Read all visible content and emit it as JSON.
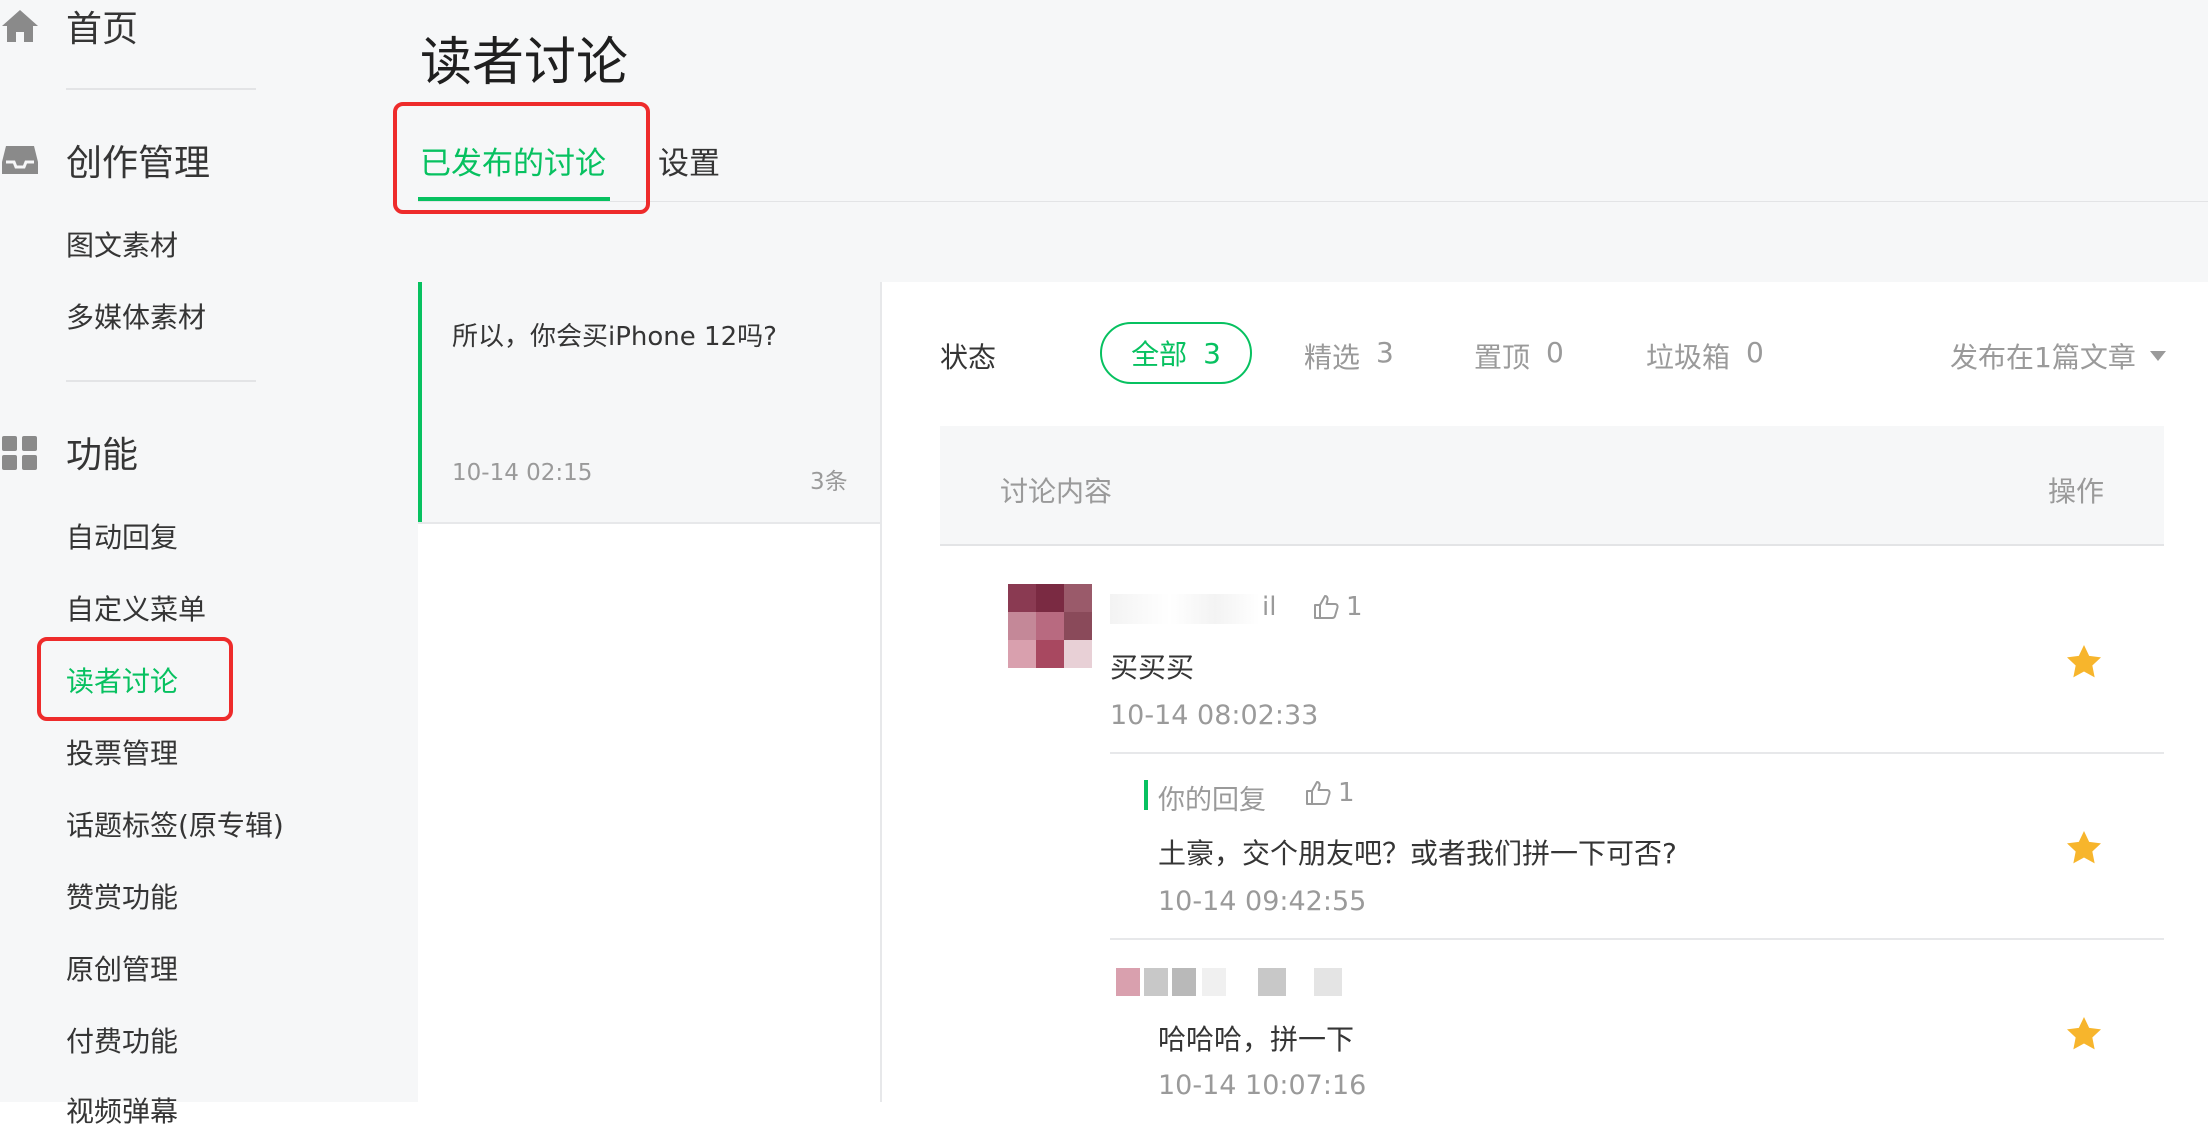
{
  "sidebar": {
    "sections": [
      {
        "label": "首页",
        "icon": "home-icon"
      },
      {
        "label": "创作管理",
        "icon": "inbox-icon"
      },
      {
        "label": "功能",
        "icon": "grid-icon"
      }
    ],
    "creation_items": [
      "图文素材",
      "多媒体素材"
    ],
    "function_items": [
      "自动回复",
      "自定义菜单",
      "读者讨论",
      "投票管理",
      "话题标签(原专辑)",
      "赞赏功能",
      "原创管理",
      "付费功能",
      "视频弹幕"
    ],
    "active_item": "读者讨论"
  },
  "header": {
    "title": "读者讨论",
    "tabs": [
      {
        "label": "已发布的讨论",
        "active": true
      },
      {
        "label": "设置",
        "active": false
      }
    ]
  },
  "articles": [
    {
      "title": "所以，你会买iPhone 12吗?",
      "time": "10-14 02:15",
      "count": "3条"
    }
  ],
  "filters": {
    "status_label": "状态",
    "items": [
      {
        "label": "全部",
        "count": "3",
        "active": true
      },
      {
        "label": "精选",
        "count": "3",
        "active": false
      },
      {
        "label": "置顶",
        "count": "0",
        "active": false
      },
      {
        "label": "垃圾箱",
        "count": "0",
        "active": false
      }
    ],
    "publish_dropdown": "发布在1篇文章"
  },
  "table": {
    "col_content": "讨论内容",
    "col_ops": "操作"
  },
  "comments": [
    {
      "name_visible": "il",
      "likes": "1",
      "text": "买买买",
      "time": "10-14 08:02:33",
      "starred": true
    },
    {
      "reply_label": "你的回复",
      "likes": "1",
      "text": "土豪，交个朋友吧？或者我们拼一下可否?",
      "time": "10-14 09:42:55",
      "starred": true
    },
    {
      "text": "哈哈哈，拼一下",
      "time": "10-14 10:07:16",
      "starred": true
    }
  ],
  "colors": {
    "accent": "#07c160",
    "star": "#f7b52c",
    "highlight_box": "#ee2b2b",
    "sidebar_bg": "#f6f7f8"
  }
}
